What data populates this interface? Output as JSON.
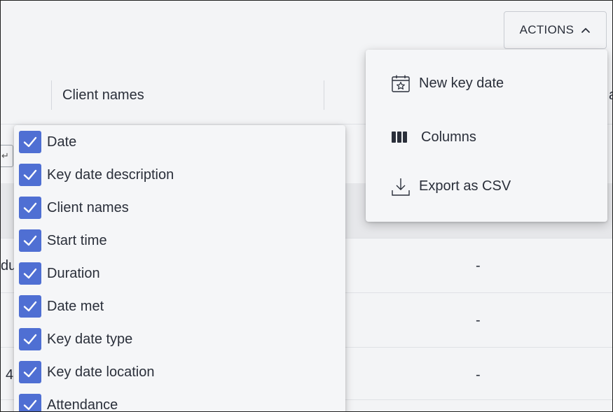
{
  "toolbar": {
    "actions_label": "ACTIONS",
    "actions_icon": "chevron-up-icon"
  },
  "table": {
    "header_label": "Client names",
    "header_partial": "ar",
    "cells": {
      "row1_dash": "-",
      "row2_dash": "-",
      "row3_dash": "-",
      "row1_frag": "du",
      "row3_frag": "4"
    }
  },
  "actions_menu": {
    "items": [
      {
        "label": "New key date",
        "icon": "calendar-star-icon"
      },
      {
        "label": "Columns",
        "icon": "columns-icon"
      },
      {
        "label": "Export as CSV",
        "icon": "download-icon"
      }
    ]
  },
  "columns_menu": {
    "options": [
      {
        "label": "Date",
        "checked": true
      },
      {
        "label": "Key date description",
        "checked": true
      },
      {
        "label": "Client names",
        "checked": true
      },
      {
        "label": "Start time",
        "checked": true
      },
      {
        "label": "Duration",
        "checked": true
      },
      {
        "label": "Date met",
        "checked": true
      },
      {
        "label": "Key date type",
        "checked": true
      },
      {
        "label": "Key date location",
        "checked": true
      },
      {
        "label": "Attendance",
        "checked": true
      }
    ]
  },
  "colors": {
    "checkbox": "#4f6fd3",
    "background": "#f3f4f6",
    "text": "#2a2f3a"
  }
}
